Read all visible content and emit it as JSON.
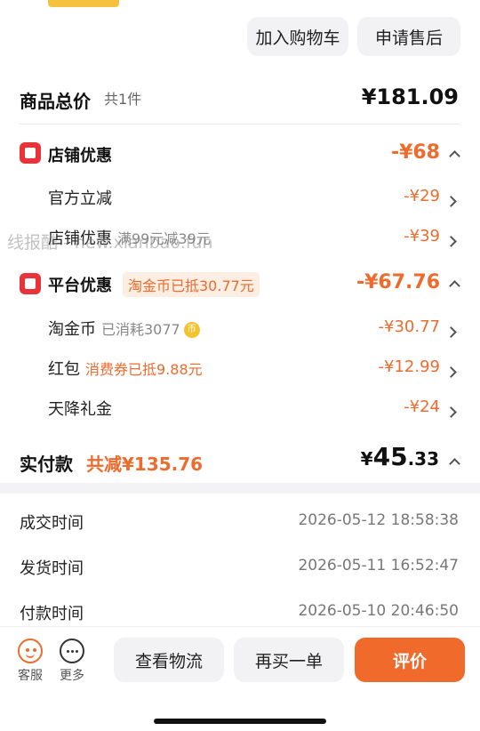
{
  "top_buttons": {
    "add_to_cart": "加入购物车",
    "after_sale": "申请售后"
  },
  "total": {
    "label": "商品总价",
    "count": "共1件",
    "amount": "¥181.09"
  },
  "store_discount": {
    "title": "店铺优惠",
    "amount": "-¥68",
    "items": [
      {
        "label": "官方立减",
        "note": "",
        "amount": "-¥29"
      },
      {
        "label": "店铺优惠",
        "note": "满99元减39元",
        "amount": "-¥39"
      }
    ]
  },
  "platform_discount": {
    "title": "平台优惠",
    "badge": "淘金币已抵30.77元",
    "amount": "-¥67.76",
    "items": [
      {
        "label": "淘金币",
        "note": "已消耗3077",
        "amount": "-¥30.77"
      },
      {
        "label": "红包",
        "note": "消费券已抵9.88元",
        "amount": "-¥12.99"
      },
      {
        "label": "天降礼金",
        "note": "",
        "amount": "-¥24"
      }
    ]
  },
  "payment": {
    "label": "实付款",
    "saved": "共减¥135.76",
    "currency": "¥",
    "amount_int": "45",
    "amount_dec": ".33"
  },
  "info": [
    {
      "label": "成交时间",
      "value": "2026-05-12 18:58:38"
    },
    {
      "label": "发货时间",
      "value": "2026-05-11 16:52:47"
    },
    {
      "label": "付款时间",
      "value": "2026-05-10 20:46:50"
    }
  ],
  "bottom": {
    "service": "客服",
    "more": "更多",
    "logistics": "查看物流",
    "rebuy": "再买一单",
    "review": "评价"
  },
  "watermark": "线报酷 - new.xianbao.fun",
  "colors": {
    "accent": "#ec6b2d",
    "store_icon": "#e8333a"
  }
}
